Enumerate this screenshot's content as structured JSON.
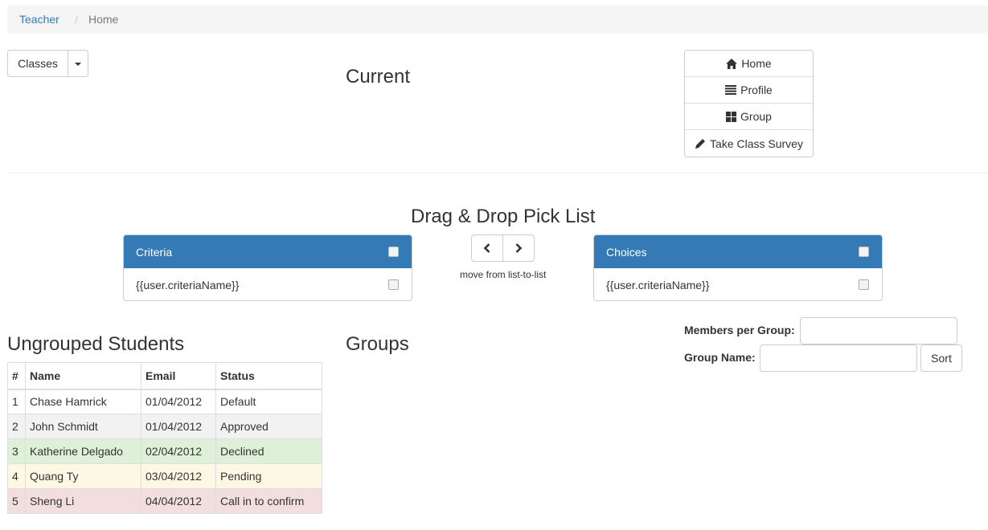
{
  "breadcrumb": {
    "parent": "Teacher",
    "separator": "/",
    "current": "Home"
  },
  "classes_button": {
    "label": "Classes"
  },
  "current_heading": "Current",
  "nav": [
    {
      "label": "Home",
      "icon": "home-icon"
    },
    {
      "label": "Profile",
      "icon": "list-icon"
    },
    {
      "label": "Group",
      "icon": "grid-icon"
    },
    {
      "label": "Take Class Survey",
      "icon": "pencil-icon"
    }
  ],
  "picklist": {
    "title": "Drag & Drop Pick List",
    "criteria": {
      "title": "Criteria",
      "item": "{{user.criteriaName}}"
    },
    "choices": {
      "title": "Choices",
      "item": "{{user.criteriaName}}"
    },
    "move_label": "move from list-to-list"
  },
  "ungrouped": {
    "heading": "Ungrouped Students",
    "columns": [
      "#",
      "Name",
      "Email",
      "Status"
    ],
    "rows": [
      {
        "num": "1",
        "name": "Chase Hamrick",
        "email": "01/04/2012",
        "status": "Default",
        "style": "default"
      },
      {
        "num": "2",
        "name": "John Schmidt",
        "email": "01/04/2012",
        "status": "Approved",
        "style": "striped"
      },
      {
        "num": "3",
        "name": "Katherine Delgado",
        "email": "02/04/2012",
        "status": "Declined",
        "style": "success"
      },
      {
        "num": "4",
        "name": "Quang Ty",
        "email": "03/04/2012",
        "status": "Pending",
        "style": "warning"
      },
      {
        "num": "5",
        "name": "Sheng Li",
        "email": "04/04/2012",
        "status": "Call in to confirm",
        "style": "danger"
      }
    ]
  },
  "groups_heading": "Groups",
  "group_form": {
    "members_label": "Members per Group:",
    "members_value": "",
    "name_label": "Group Name:",
    "name_value": "",
    "sort_label": "Sort"
  },
  "colors": {
    "primary": "#337ab7",
    "link": "#337ab7",
    "success": "#dff0d8",
    "warning": "#fcf8e3",
    "danger": "#f2dede"
  }
}
